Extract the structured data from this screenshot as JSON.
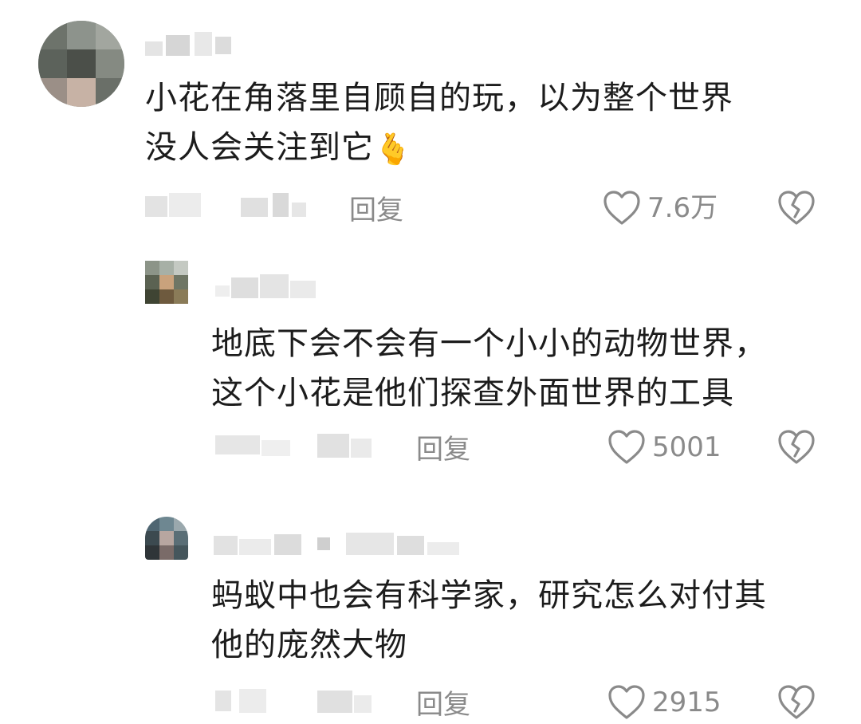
{
  "comments": [
    {
      "text_line1": "小花在角落里自顾自的玩，以为整个世界",
      "text_line2": "没人会关注到它",
      "emoji": "🫰",
      "reply_label": "回复",
      "like_count": "7.6万"
    },
    {
      "text_line1": "地底下会不会有一个小小的动物世界，",
      "text_line2": "这个小花是他们探查外面世界的工具",
      "reply_label": "回复",
      "like_count": "5001"
    },
    {
      "text_line1": "蚂蚁中也会有科学家，研究怎么对付其",
      "text_line2": "他的庞然大物",
      "reply_label": "回复",
      "like_count": "2915"
    }
  ],
  "icons": {
    "like": "heart-outline-icon",
    "dislike": "broken-heart-icon"
  },
  "colors": {
    "text": "#1c1c1c",
    "meta": "#8a8a8a",
    "background": "#ffffff"
  }
}
